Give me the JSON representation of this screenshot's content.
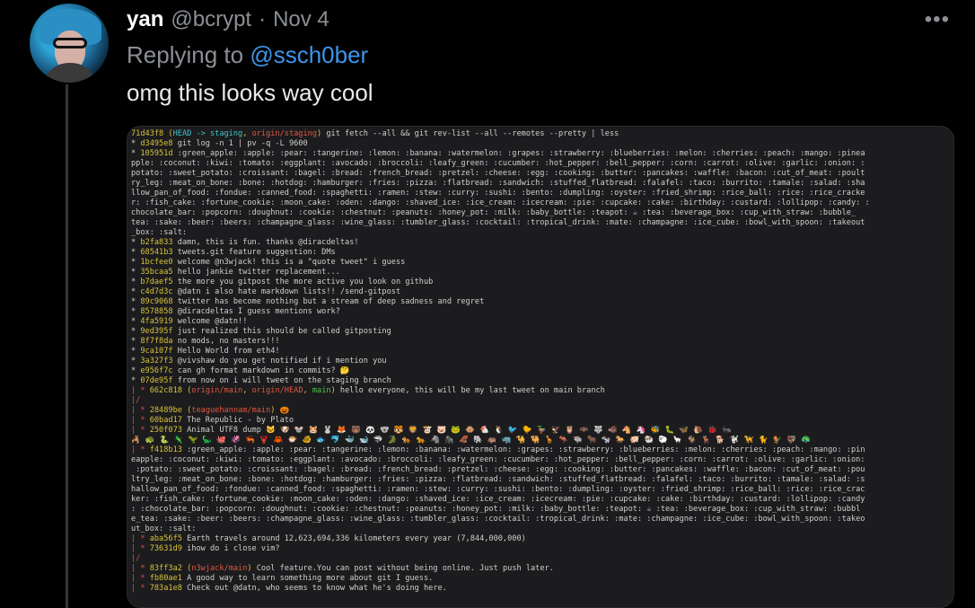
{
  "author": {
    "name": "yan",
    "handle": "@bcrypt",
    "separator": "·",
    "date": "Nov 4"
  },
  "more_label": "•••",
  "reply": {
    "prefix": "Replying to ",
    "mention": "@ssch0ber"
  },
  "tweet_text": "omg this looks way cool",
  "terminal": {
    "lines": [
      "71d43f8 (HEAD -> staging, origin/staging) git fetch --all && git rev-list --all --remotes --pretty | less",
      "* d3495e8 git log -n 1 | pv -q -L 9600",
      "* 105951d :green_apple: :apple: :pear: :tangerine: :lemon: :banana: :watermelon: :grapes: :strawberry: :blueberries: :melon: :cherries: :peach: :mango: :pinea",
      "pple: :coconut: :kiwi: :tomato: :eggplant: :avocado: :broccoli: :leafy_green: :cucumber: :hot_pepper: :bell_pepper: :corn: :carrot: :olive: :garlic: :onion: :",
      "potato: :sweet_potato: :croissant: :bagel: :bread: :french_bread: :pretzel: :cheese: :egg: :cooking: :butter: :pancakes: :waffle: :bacon: :cut_of_meat: :poult",
      "ry_leg: :meat_on_bone: :bone: :hotdog: :hamburger: :fries: :pizza: :flatbread: :sandwich: :stuffed_flatbread: :falafel: :taco: :burrito: :tamale: :salad: :sha",
      "llow_pan_of_food: :fondue: :canned_food: :spaghetti: :ramen: :stew: :curry: :sushi: :bento: :dumpling: :oyster: :fried_shrimp: :rice_ball: :rice: :rice_cracke",
      "r: :fish_cake: :fortune_cookie: :moon_cake: :oden: :dango: :shaved_ice: :ice_cream: :icecream: :pie: :cupcake: :cake: :birthday: :custard: :lollipop: :candy: :",
      "chocolate_bar: :popcorn: :doughnut: :cookie: :chestnut: :peanuts: :honey_pot: :milk: :baby_bottle: :teapot: ☕ :tea: :beverage_box: :cup_with_straw: :bubble_",
      "tea: :sake: :beer: :beers: :champagne_glass: :wine_glass: :tumbler_glass: :cocktail: :tropical_drink: :mate: :champagne: :ice_cube: :bowl_with_spoon: :takeout",
      "_box: :salt:",
      "* b2fa833 damn, this is fun. thanks @diracdeltas!",
      "* 68541b3 tweets.git feature suggestion: DMs",
      "* 1bcfee0 welcome @n3wjack! this is a \"quote tweet\" i guess",
      "* 35bcaa5 hello jankie twitter replacement...",
      "* b7daef5 the more you gitpost the more active you look on github",
      "* c4d7d3c @datn i also hate markdown lists!! /send-gitpost",
      "* 89c9068 twitter has become nothing but a stream of deep sadness and regret",
      "* 8578858 @diracdeltas I guess mentions work?",
      "* 4fa5919 welcome @datn!!",
      "* 9ed395f just realized this should be called gitposting",
      "* 8f7f8da no mods, no masters!!!",
      "* 9ca107f Hello World from eth4!",
      "* 3a327f3 @vivshaw do you get notified if i mention you",
      "* e956f7c can gh format markdown in commits? 🤔",
      "* 07de95f from now on i will tweet on the staging branch",
      "| * 662c818 (origin/main, origin/HEAD, main) hello everyone, this will be my last tweet on main branch",
      "|/",
      "| * 28489be (teaguehannam/main) 🎃",
      "| * 60bad17 The Republic - by Plato",
      "| * 250f073 Animal UTF8 dump 🐱 🐶 🐭 🐹 🐰 🦊 🐻 🐼 🐨 🐯 🦁 🐮 🐷 🐸 🐵 🐔 🐧 🐦 🐤 🦆 🦅 🦉 🦇 🐺 🐗 🐴 🦄 🐝 🐛 🦋 🐌 🐞 🐜",
      "🦂 🐢 🐍 🦎 🦖 🦕 🐙 🦑 🦐 🦞 🦀 🐡 🐠 🐟 🐬 🐳 🐋 🦈 🐊 🐅 🐆 🦓 🦍 🦧 🐘 🦛 🦏 🐪 🐫 🦒 🦘 🐃 🐂 🐄 🐎 🐖 🐏 🐑 🦙 🐐 🦌 🐕 🐩 🦮 🐈 🐓 🦃 🦚",
      "| * f418b13 :green_apple: :apple: :pear: :tangerine: :lemon: :banana: :watermelon: :grapes: :strawberry: :blueberries: :melon: :cherries: :peach: :mango: :pin",
      "eapple: :coconut: :kiwi: :tomato: :eggplant: :avocado: :broccoli: :leafy_green: :cucumber: :hot_pepper: :bell_pepper: :corn: :carrot: :olive: :garlic: :onion:",
      " :potato: :sweet_potato: :croissant: :bagel: :bread: :french_bread: :pretzel: :cheese: :egg: :cooking: :butter: :pancakes: :waffle: :bacon: :cut_of_meat: :pou",
      "ltry_leg: :meat_on_bone: :bone: :hotdog: :hamburger: :fries: :pizza: :flatbread: :sandwich: :stuffed_flatbread: :falafel: :taco: :burrito: :tamale: :salad: :s",
      "hallow_pan_of_food: :fondue: :canned_food: :spaghetti: :ramen: :stew: :curry: :sushi: :bento: :dumpling: :oyster: :fried_shrimp: :rice_ball: :rice: :rice_crac",
      "ker: :fish_cake: :fortune_cookie: :moon_cake: :oden: :dango: :shaved_ice: :ice_cream: :icecream: :pie: :cupcake: :cake: :birthday: :custard: :lollipop: :candy",
      ": :chocolate_bar: :popcorn: :doughnut: :cookie: :chestnut: :peanuts: :honey_pot: :milk: :baby_bottle: :teapot: ☕ :tea: :beverage_box: :cup_with_straw: :bubbl",
      "e_tea: :sake: :beer: :beers: :champagne_glass: :wine_glass: :tumbler_glass: :cocktail: :tropical_drink: :mate: :champagne: :ice_cube: :bowl_with_spoon: :takeo",
      "ut_box: :salt:",
      "| * aba56f5 Earth travels around 12,623,694,336 kilometers every year (7,844,000,000)",
      "| * 73631d9 ihow do i close vim?",
      "|/",
      "| * 83ff3a2 (n3wjack/main) Cool feature.You can post without being online. Just push later.",
      "| * fb80ae1 A good way to learn something more about git I guess.",
      "| * 783a1e8 Check out @datn, who seems to know what he's doing here."
    ]
  }
}
